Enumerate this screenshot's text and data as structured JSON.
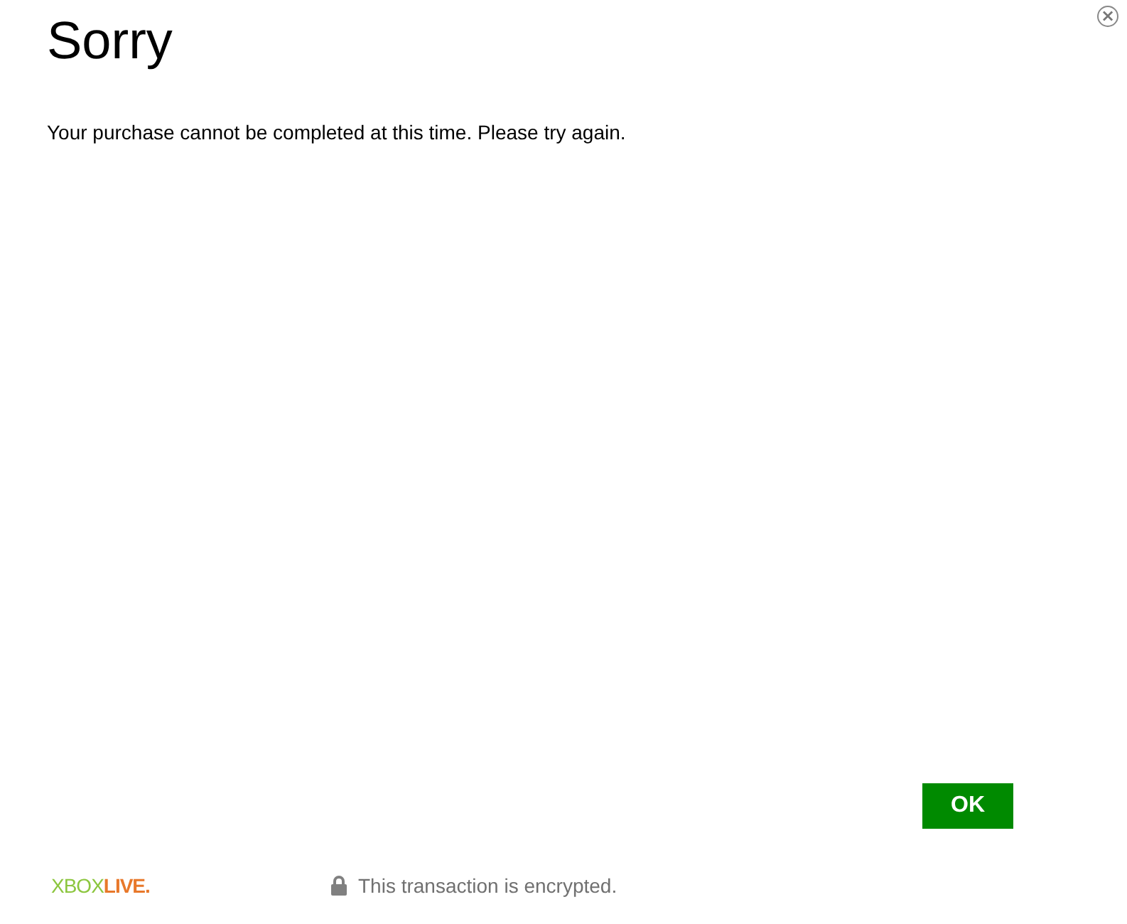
{
  "dialog": {
    "title": "Sorry",
    "message": "Your purchase cannot be completed at this time. Please try again.",
    "close_button": "×"
  },
  "buttons": [
    {
      "label": "OK"
    }
  ],
  "footer": {
    "logo": {
      "brand": "XBOX",
      "product": "LIVE."
    },
    "security_note": "This transaction is encrypted."
  }
}
